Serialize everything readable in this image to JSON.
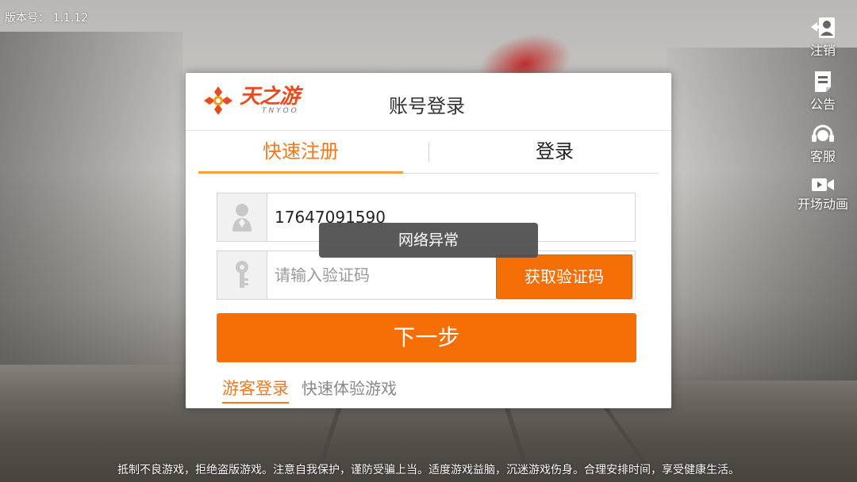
{
  "version": {
    "label": "版本号：",
    "value": "1.1.12"
  },
  "side_menu": {
    "items": [
      {
        "label": "注销",
        "icon": "logout-user-icon"
      },
      {
        "label": "公告",
        "icon": "notice-document-icon"
      },
      {
        "label": "客服",
        "icon": "customer-service-headset-icon"
      },
      {
        "label": "开场动画",
        "icon": "video-camera-icon"
      }
    ]
  },
  "dialog": {
    "logo": {
      "main": "天之游",
      "sub": "TNYOO"
    },
    "title": "账号登录",
    "tabs": [
      {
        "label": "快速注册",
        "active": true
      },
      {
        "label": "登录",
        "active": false
      }
    ],
    "phone_field": {
      "value": "17647091590",
      "icon": "user-icon"
    },
    "code_field": {
      "value": "",
      "placeholder": "请输入验证码",
      "icon": "key-icon"
    },
    "get_code_label": "获取验证码",
    "next_label": "下一步",
    "guest_login_label": "游客登录",
    "guest_desc": "快速体验游戏"
  },
  "toast": "网络异常",
  "notice": "抵制不良游戏，拒绝盗版游戏。注意自我保护，谨防受骗上当。适度游戏益脑，沉迷游戏伤身。合理安排时间，享受健康生活。",
  "colors": {
    "accent": "#f56e06",
    "tab_active": "#f2781e",
    "toast_bg": "#505050"
  }
}
